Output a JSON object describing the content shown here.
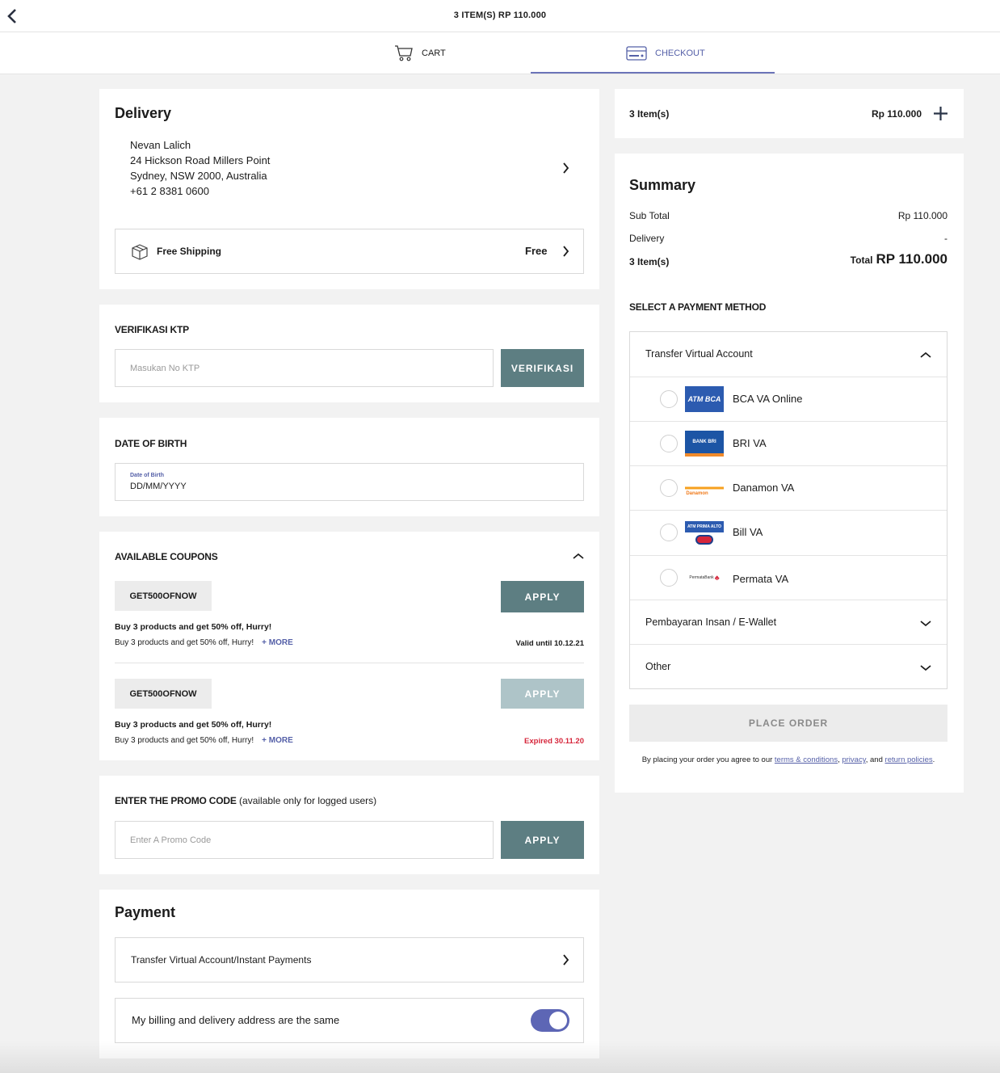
{
  "header": {
    "title": "3 ITEM(S) RP 110.000",
    "back_icon": "chevron-left-icon"
  },
  "tabs": {
    "cart": "CART",
    "checkout": "CHECKOUT"
  },
  "delivery": {
    "title": "Delivery",
    "name": "Nevan Lalich",
    "address_line1": "24 Hickson Road Millers Point",
    "address_line2": "Sydney, NSW 2000, Australia",
    "phone": "+61 2 8381 0600",
    "shipping_label": "Free Shipping",
    "shipping_price": "Free"
  },
  "ktp": {
    "title": "VERIFIKASI KTP",
    "placeholder": "Masukan No KTP",
    "button": "VERIFIKASI"
  },
  "dob": {
    "title": "DATE OF BIRTH",
    "label": "Date of Birth",
    "value": "DD/MM/YYYY"
  },
  "coupons": {
    "title": "AVAILABLE COUPONS",
    "items": [
      {
        "code": "GET500OFNOW",
        "button": "APPLY",
        "headline": "Buy 3 products and get 50% off, Hurry!",
        "desc": "Buy 3 products and get 50% off, Hurry!",
        "more": "+ MORE",
        "validity": "Valid until 10.12.21"
      },
      {
        "code": "GET500OFNOW",
        "button": "APPLY",
        "headline": "Buy 3 products and get 50% off, Hurry!",
        "desc": "Buy 3 products and get 50% off, Hurry!",
        "more": "+ MORE",
        "validity": "Expired 30.11.20"
      }
    ]
  },
  "promo": {
    "title_bold": "ENTER THE PROMO CODE",
    "title_note": "(available only for logged users)",
    "placeholder": "Enter A Promo Code",
    "button": "APPLY"
  },
  "payment": {
    "title": "Payment",
    "method": "Transfer Virtual Account/Instant Payments",
    "billing_same": "My billing and delivery address are the same",
    "billing_same_on": true
  },
  "items_bar": {
    "count": "3 Item(s)",
    "price": "Rp 110.000"
  },
  "summary": {
    "title": "Summary",
    "subtotal_label": "Sub Total",
    "subtotal_value": "Rp 110.000",
    "delivery_label": "Delivery",
    "delivery_value": "-",
    "items_label": "3 Item(s)",
    "total_label": "Total",
    "total_value": "RP 110.000",
    "payment_title": "SELECT A PAYMENT METHOD",
    "groups": [
      {
        "label": "Transfer Virtual Account"
      },
      {
        "label": "Pembayaran Insan / E-Wallet"
      },
      {
        "label": "Other"
      }
    ],
    "va_options": [
      {
        "label": "BCA VA Online",
        "logo": "ATM BCA"
      },
      {
        "label": "BRI VA",
        "logo": "BANK BRI"
      },
      {
        "label": "Danamon VA",
        "logo": "Danamon"
      },
      {
        "label": "Bill VA",
        "logo": "ATM PRIMA ALTO"
      },
      {
        "label": "Permata VA",
        "logo": "PermataBank"
      }
    ],
    "place_order": "PLACE ORDER",
    "terms_prefix": "By placing your order you agree to our",
    "terms_link": "terms & conditions",
    "privacy_link": "privacy",
    "and_text": ", and",
    "return_link": "return policies",
    "period": "."
  },
  "colors": {
    "accent": "#5560a8",
    "button_teal": "#5d7e82",
    "button_teal_disabled": "#aec4c8",
    "expired_red": "#d6263b",
    "background": "#f2f2f2"
  }
}
